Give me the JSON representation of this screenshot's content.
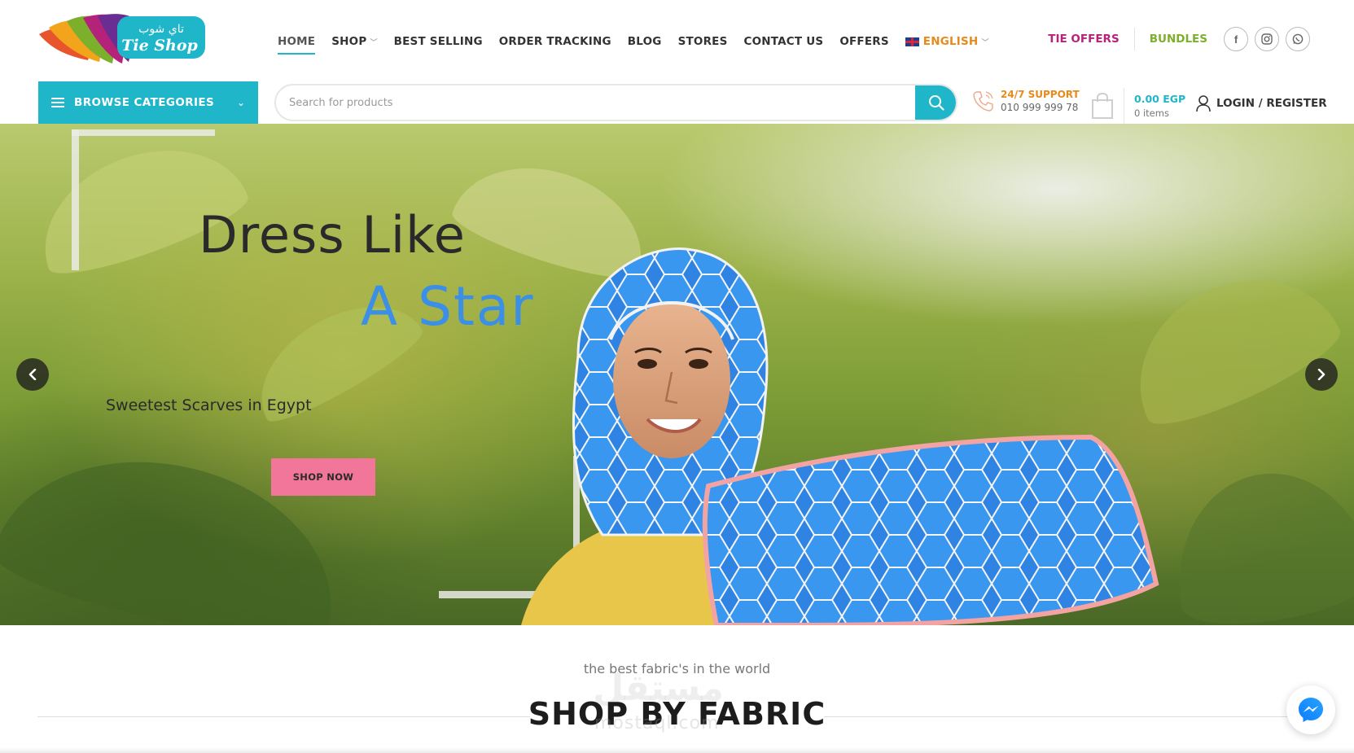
{
  "logo": {
    "arabic": "تاي شوب",
    "latin": "Tie Shop"
  },
  "nav": {
    "items": [
      {
        "label": "HOME"
      },
      {
        "label": "SHOP"
      },
      {
        "label": "BEST SELLING"
      },
      {
        "label": "ORDER TRACKING"
      },
      {
        "label": "BLOG"
      },
      {
        "label": "STORES"
      },
      {
        "label": "CONTACT US"
      },
      {
        "label": "OFFERS"
      }
    ],
    "language": "ENGLISH",
    "tie_offers": "TIE OFFERS",
    "bundles": "BUNDLES",
    "social": {
      "facebook": "f",
      "instagram": "◎",
      "whatsapp": "✆"
    }
  },
  "browse": {
    "label": "BROWSE CATEGORIES"
  },
  "search": {
    "placeholder": "Search for products"
  },
  "support": {
    "title": "24/7 SUPPORT",
    "phone": "010 999 999 78"
  },
  "cart": {
    "total": "0.00 EGP",
    "items": "0 items"
  },
  "account": {
    "label": "LOGIN / REGISTER"
  },
  "hero": {
    "line1": "Dress Like",
    "line2": "A Star",
    "subtitle": "Sweetest Scarves in Egypt",
    "cta": "SHOP NOW"
  },
  "section": {
    "subtitle": "the best fabric's in the world",
    "title": "SHOP BY FABRIC"
  },
  "watermark": {
    "arabic": "مستقل",
    "latin": "mostaql.com"
  },
  "colors": {
    "accent": "#1fb6c9",
    "orange": "#e88a1a",
    "offers": "#b5227a",
    "bundles": "#7cb02c",
    "cta": "#f2769a",
    "hero_star": "#3b8fe6"
  },
  "icons": {
    "menu": "hamburger-icon",
    "search": "search-icon",
    "support": "phone-icon",
    "cart": "shopping-bag-icon",
    "user": "user-icon",
    "prev": "chevron-left-icon",
    "next": "chevron-right-icon",
    "chat": "messenger-icon"
  }
}
